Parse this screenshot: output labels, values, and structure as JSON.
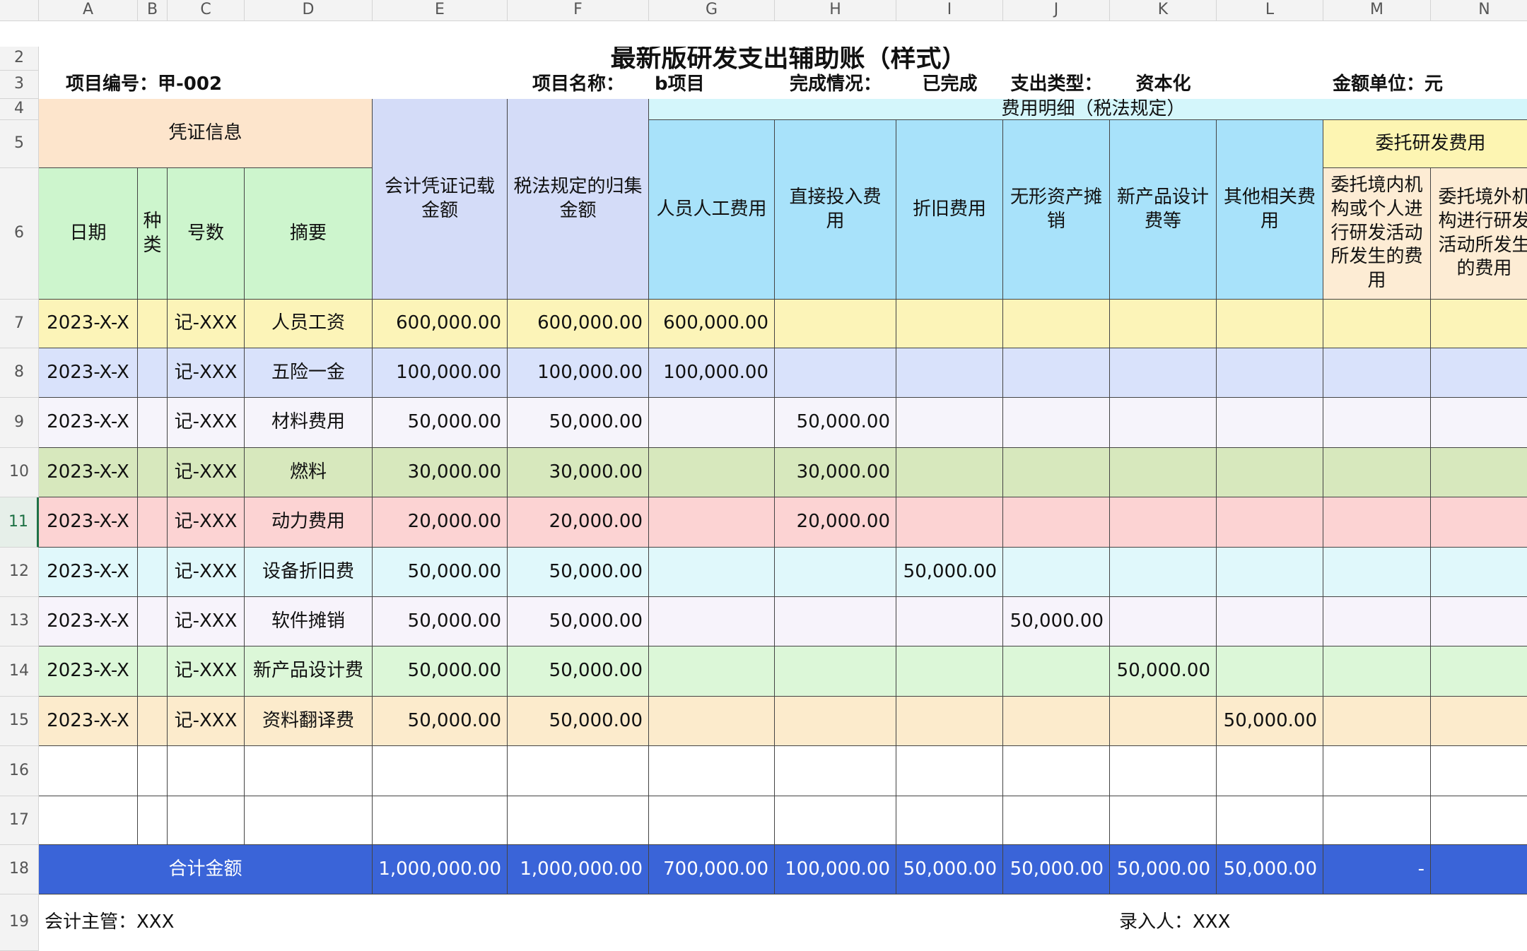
{
  "columns": [
    "A",
    "B",
    "C",
    "D",
    "E",
    "F",
    "G",
    "H",
    "I",
    "J",
    "K",
    "L",
    "M",
    "N"
  ],
  "rows": [
    "2",
    "3",
    "4",
    "5",
    "6",
    "7",
    "8",
    "9",
    "10",
    "11",
    "12",
    "13",
    "14",
    "15",
    "16",
    "17",
    "18",
    "19"
  ],
  "title": "最新版研发支出辅助账（样式）",
  "info": {
    "project_code": "项目编号：甲-002",
    "project_name_label": "项目名称：",
    "project_name_value": "b项目",
    "status_label": "完成情况：",
    "status_value": "已完成",
    "type_label": "支出类型：",
    "type_value": "资本化",
    "unit": "金额单位：元"
  },
  "headers": {
    "voucher_info": "凭证信息",
    "date": "日期",
    "kind": "种类",
    "number": "号数",
    "summary": "摘要",
    "accounting_amount": "会计凭证记载金额",
    "tax_amount": "税法规定的归集金额",
    "expense_detail": "费用明细（税法规定）",
    "entrusted": "委托研发费用",
    "personnel": "人员人工费用",
    "direct_input": "直接投入费用",
    "depreciation": "折旧费用",
    "intangible": "无形资产摊销",
    "new_product": "新产品设计费等",
    "other": "其他相关费用",
    "entrusted_domestic": "委托境内机构或个人进行研发活动所发生的费用",
    "entrusted_foreign": "委托境外机构进行研发活动所发生的费用"
  },
  "records": [
    {
      "date": "2023-X-X",
      "kind": "",
      "number": "记-XXX",
      "summary": "人员工资",
      "e": "600,000.00",
      "f": "600,000.00",
      "g": "600,000.00",
      "h": "",
      "i": "",
      "j": "",
      "k": "",
      "l": "",
      "m": "",
      "n": "",
      "color": "#fcf4b8"
    },
    {
      "date": "2023-X-X",
      "kind": "",
      "number": "记-XXX",
      "summary": "五险一金",
      "e": "100,000.00",
      "f": "100,000.00",
      "g": "100,000.00",
      "h": "",
      "i": "",
      "j": "",
      "k": "",
      "l": "",
      "m": "",
      "n": "",
      "color": "#d9e2fb"
    },
    {
      "date": "2023-X-X",
      "kind": "",
      "number": "记-XXX",
      "summary": "材料费用",
      "e": "50,000.00",
      "f": "50,000.00",
      "g": "",
      "h": "50,000.00",
      "i": "",
      "j": "",
      "k": "",
      "l": "",
      "m": "",
      "n": "",
      "color": "#f6f4fb"
    },
    {
      "date": "2023-X-X",
      "kind": "",
      "number": "记-XXX",
      "summary": "燃料",
      "e": "30,000.00",
      "f": "30,000.00",
      "g": "",
      "h": "30,000.00",
      "i": "",
      "j": "",
      "k": "",
      "l": "",
      "m": "",
      "n": "",
      "color": "#d7e8bd"
    },
    {
      "date": "2023-X-X",
      "kind": "",
      "number": "记-XXX",
      "summary": "动力费用",
      "e": "20,000.00",
      "f": "20,000.00",
      "g": "",
      "h": "20,000.00",
      "i": "",
      "j": "",
      "k": "",
      "l": "",
      "m": "",
      "n": "",
      "color": "#fcd3d3"
    },
    {
      "date": "2023-X-X",
      "kind": "",
      "number": "记-XXX",
      "summary": "设备折旧费",
      "e": "50,000.00",
      "f": "50,000.00",
      "g": "",
      "h": "",
      "i": "50,000.00",
      "j": "",
      "k": "",
      "l": "",
      "m": "",
      "n": "",
      "color": "#e0f8fb"
    },
    {
      "date": "2023-X-X",
      "kind": "",
      "number": "记-XXX",
      "summary": "软件摊销",
      "e": "50,000.00",
      "f": "50,000.00",
      "g": "",
      "h": "",
      "i": "",
      "j": "50,000.00",
      "k": "",
      "l": "",
      "m": "",
      "n": "",
      "color": "#f7f3fb"
    },
    {
      "date": "2023-X-X",
      "kind": "",
      "number": "记-XXX",
      "summary": "新产品设计费",
      "e": "50,000.00",
      "f": "50,000.00",
      "g": "",
      "h": "",
      "i": "",
      "j": "",
      "k": "50,000.00",
      "l": "",
      "m": "",
      "n": "",
      "color": "#dcf7d8"
    },
    {
      "date": "2023-X-X",
      "kind": "",
      "number": "记-XXX",
      "summary": "资料翻译费",
      "e": "50,000.00",
      "f": "50,000.00",
      "g": "",
      "h": "",
      "i": "",
      "j": "",
      "k": "",
      "l": "50,000.00",
      "m": "",
      "n": "",
      "color": "#fcebcc"
    },
    {
      "date": "",
      "kind": "",
      "number": "",
      "summary": "",
      "e": "",
      "f": "",
      "g": "",
      "h": "",
      "i": "",
      "j": "",
      "k": "",
      "l": "",
      "m": "",
      "n": "",
      "color": "#ffffff"
    },
    {
      "date": "",
      "kind": "",
      "number": "",
      "summary": "",
      "e": "",
      "f": "",
      "g": "",
      "h": "",
      "i": "",
      "j": "",
      "k": "",
      "l": "",
      "m": "",
      "n": "",
      "color": "#ffffff"
    }
  ],
  "total": {
    "label": "合计金额",
    "e": "1,000,000.00",
    "f": "1,000,000.00",
    "g": "700,000.00",
    "h": "100,000.00",
    "i": "50,000.00",
    "j": "50,000.00",
    "k": "50,000.00",
    "l": "50,000.00",
    "m": "-",
    "n": ""
  },
  "footer": {
    "supervisor": "会计主管：XXX",
    "recorder": "录入人：XXX"
  },
  "colors": {
    "voucher_header": "#fde5cc",
    "voucher_subheader": "#cdf5cd",
    "amount_header": "#d4dcf8",
    "expense_header": "#d4f6fb",
    "expense_subheader": "#a8e2fa",
    "entrusted_header": "#fdf5b2",
    "entrusted_subheader": "#fdecd4",
    "total": "#3a64d8"
  }
}
